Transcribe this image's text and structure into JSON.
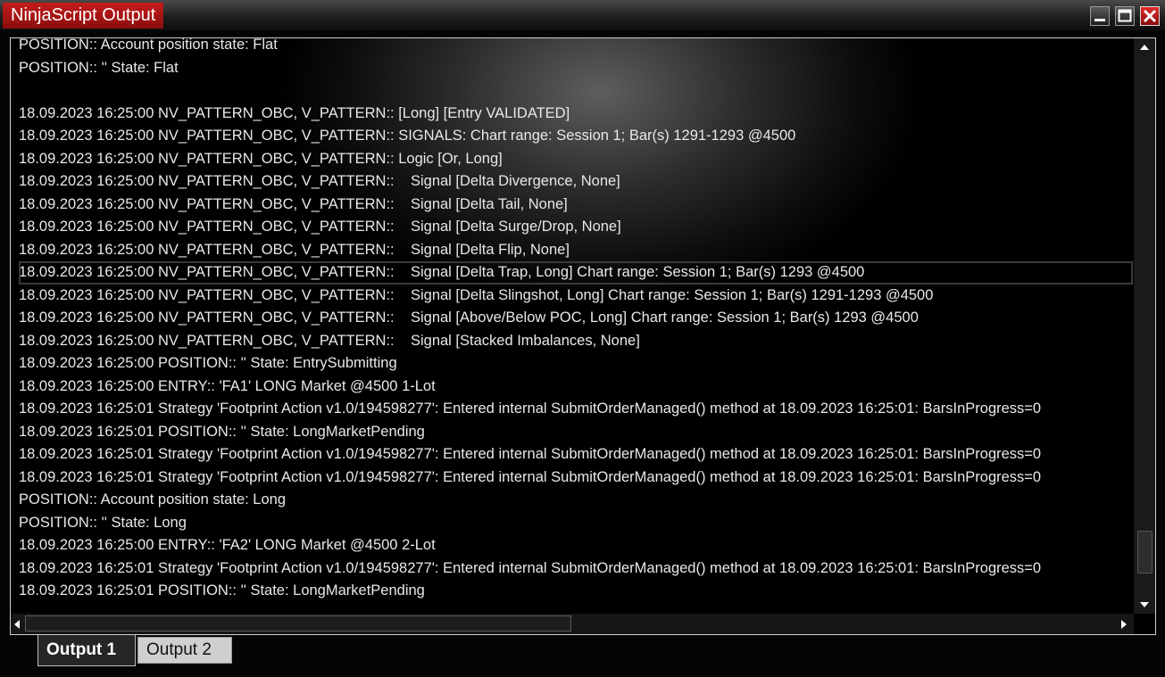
{
  "window": {
    "title": "NinjaScript Output",
    "buttons": [
      "minimize-icon",
      "maximize-icon",
      "close-icon"
    ],
    "accent": "#b01414"
  },
  "output": {
    "lines": [
      "POSITION:: Account position state: Flat",
      "POSITION:: '' State: Flat",
      "",
      "18.09.2023 16:25:00 NV_PATTERN_OBC, V_PATTERN:: [Long] [Entry VALIDATED]",
      "18.09.2023 16:25:00 NV_PATTERN_OBC, V_PATTERN:: SIGNALS: Chart range: Session 1; Bar(s) 1291-1293 @4500",
      "18.09.2023 16:25:00 NV_PATTERN_OBC, V_PATTERN:: Logic [Or, Long]",
      "18.09.2023 16:25:00 NV_PATTERN_OBC, V_PATTERN::    Signal [Delta Divergence, None]",
      "18.09.2023 16:25:00 NV_PATTERN_OBC, V_PATTERN::    Signal [Delta Tail, None]",
      "18.09.2023 16:25:00 NV_PATTERN_OBC, V_PATTERN::    Signal [Delta Surge/Drop, None]",
      "18.09.2023 16:25:00 NV_PATTERN_OBC, V_PATTERN::    Signal [Delta Flip, None]",
      "18.09.2023 16:25:00 NV_PATTERN_OBC, V_PATTERN::    Signal [Delta Trap, Long] Chart range: Session 1; Bar(s) 1293 @4500",
      "18.09.2023 16:25:00 NV_PATTERN_OBC, V_PATTERN::    Signal [Delta Slingshot, Long] Chart range: Session 1; Bar(s) 1291-1293 @4500",
      "18.09.2023 16:25:00 NV_PATTERN_OBC, V_PATTERN::    Signal [Above/Below POC, Long] Chart range: Session 1; Bar(s) 1293 @4500",
      "18.09.2023 16:25:00 NV_PATTERN_OBC, V_PATTERN::    Signal [Stacked Imbalances, None]",
      "18.09.2023 16:25:00 POSITION:: '' State: EntrySubmitting",
      "18.09.2023 16:25:00 ENTRY:: 'FA1' LONG Market @4500 1-Lot",
      "18.09.2023 16:25:01 Strategy 'Footprint Action v1.0/194598277': Entered internal SubmitOrderManaged() method at 18.09.2023 16:25:01: BarsInProgress=0",
      "18.09.2023 16:25:01 POSITION:: '' State: LongMarketPending",
      "18.09.2023 16:25:01 Strategy 'Footprint Action v1.0/194598277': Entered internal SubmitOrderManaged() method at 18.09.2023 16:25:01: BarsInProgress=0",
      "18.09.2023 16:25:01 Strategy 'Footprint Action v1.0/194598277': Entered internal SubmitOrderManaged() method at 18.09.2023 16:25:01: BarsInProgress=0",
      "POSITION:: Account position state: Long",
      "POSITION:: '' State: Long",
      "18.09.2023 16:25:00 ENTRY:: 'FA2' LONG Market @4500 2-Lot",
      "18.09.2023 16:25:01 Strategy 'Footprint Action v1.0/194598277': Entered internal SubmitOrderManaged() method at 18.09.2023 16:25:01: BarsInProgress=0",
      "18.09.2023 16:25:01 POSITION:: '' State: LongMarketPending"
    ],
    "selected_line_index": 10,
    "vertical_scroll_fraction": 0.93,
    "horizontal_scroll_fraction": 0.0
  },
  "tabs": [
    {
      "label": "Output 1",
      "active": true
    },
    {
      "label": "Output 2",
      "active": false
    }
  ]
}
